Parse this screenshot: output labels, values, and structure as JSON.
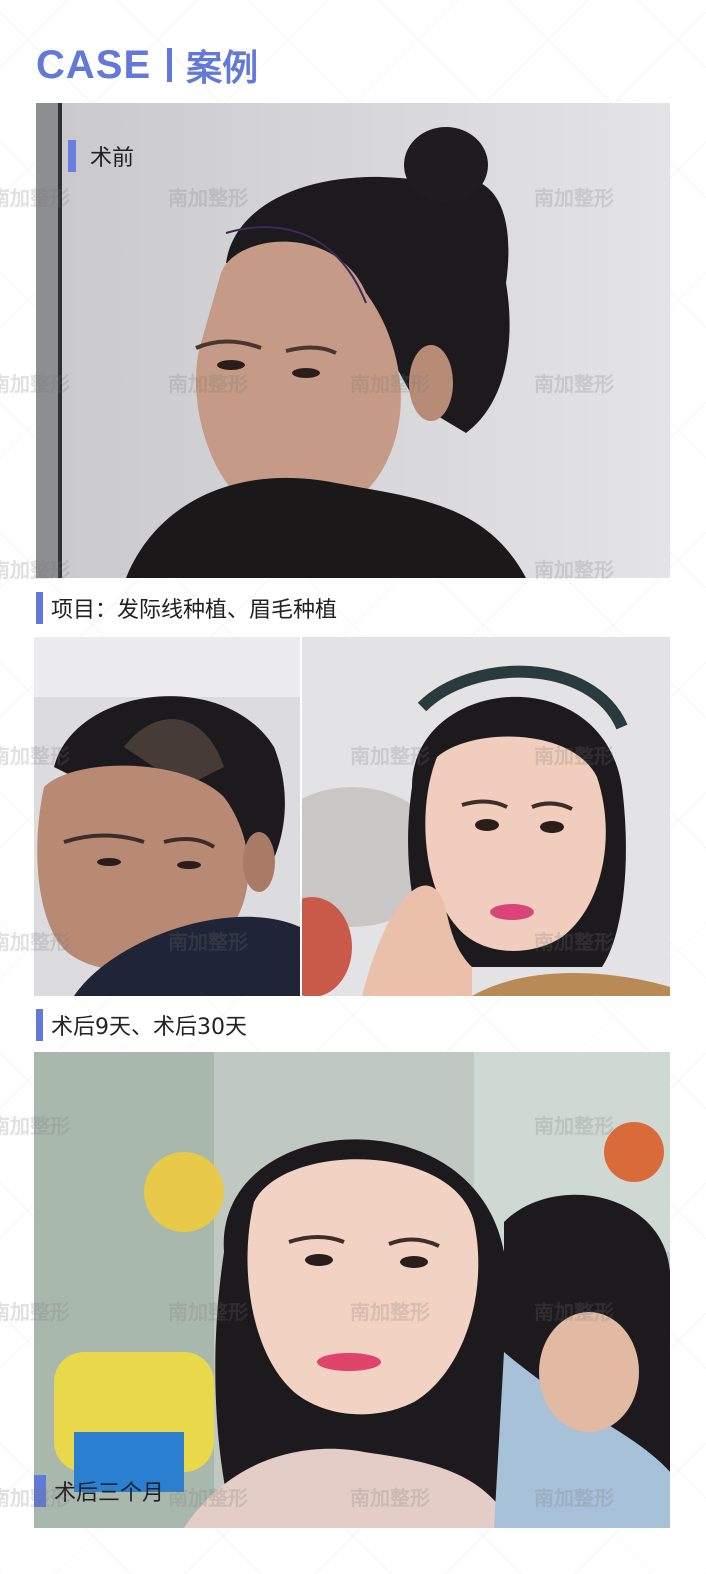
{
  "header": {
    "title_en": "CASE",
    "title_zh": "案例"
  },
  "watermark": "南加整形",
  "photos": {
    "before": {
      "label": "术前"
    },
    "after_9_days": {},
    "after_30_days": {},
    "after_3_months": {
      "label": "术后三个月"
    }
  },
  "captions": {
    "project": "项目：发际线种植、眉毛种植",
    "after": "术后9天、术后30天"
  },
  "colors": {
    "accent": "#6379d8",
    "text": "#222222"
  }
}
